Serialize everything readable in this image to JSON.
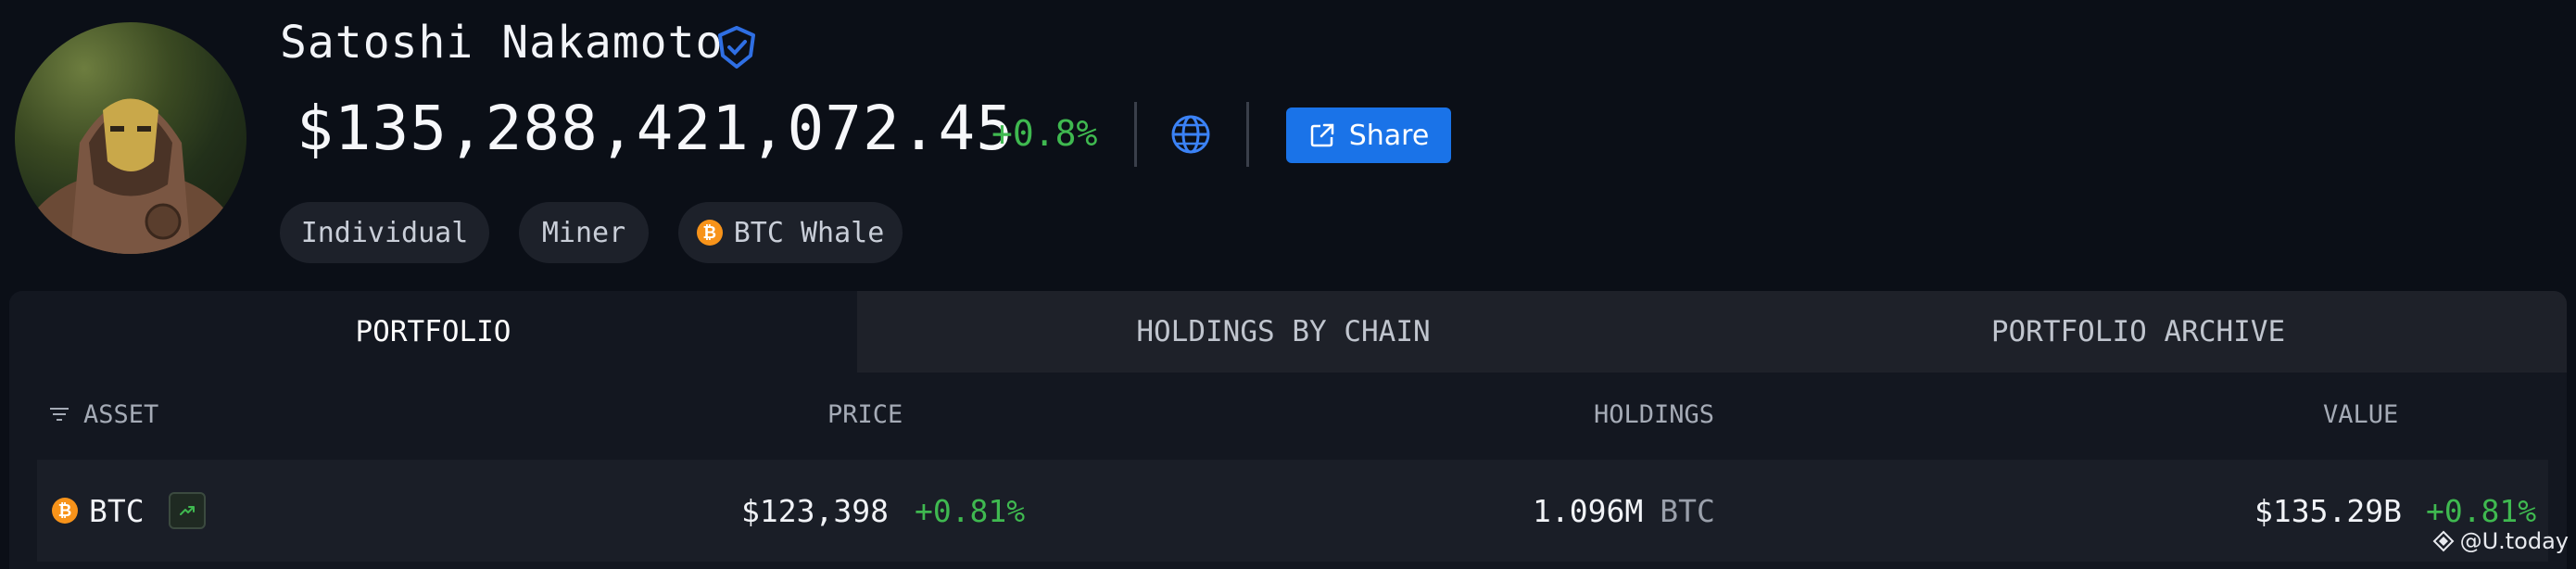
{
  "profile": {
    "name": "Satoshi Nakamoto",
    "verified_icon": "verified-shield-icon",
    "networth": "$135,288,421,072.45",
    "networth_change": "+0.8%",
    "share_label": "Share",
    "tags": [
      {
        "label": "Individual"
      },
      {
        "label": "Miner"
      },
      {
        "label": "BTC Whale",
        "icon": "btc-coin-icon"
      }
    ]
  },
  "tabs": [
    {
      "label": "PORTFOLIO",
      "active": true
    },
    {
      "label": "HOLDINGS BY CHAIN",
      "active": false
    },
    {
      "label": "PORTFOLIO ARCHIVE",
      "active": false
    }
  ],
  "table": {
    "headers": {
      "asset": "ASSET",
      "price": "PRICE",
      "holdings": "HOLDINGS",
      "value": "VALUE"
    },
    "rows": [
      {
        "asset": "BTC",
        "price": "$123,398",
        "price_change": "+0.81%",
        "holdings_amount": "1.096M",
        "holdings_unit": "BTC",
        "value": "$135.29B",
        "value_change": "+0.81%"
      }
    ]
  },
  "watermark": "@U.today",
  "colors": {
    "accent": "#1a73e8",
    "positive": "#3fb950",
    "btc": "#f7931a",
    "background": "#0b0f17"
  }
}
